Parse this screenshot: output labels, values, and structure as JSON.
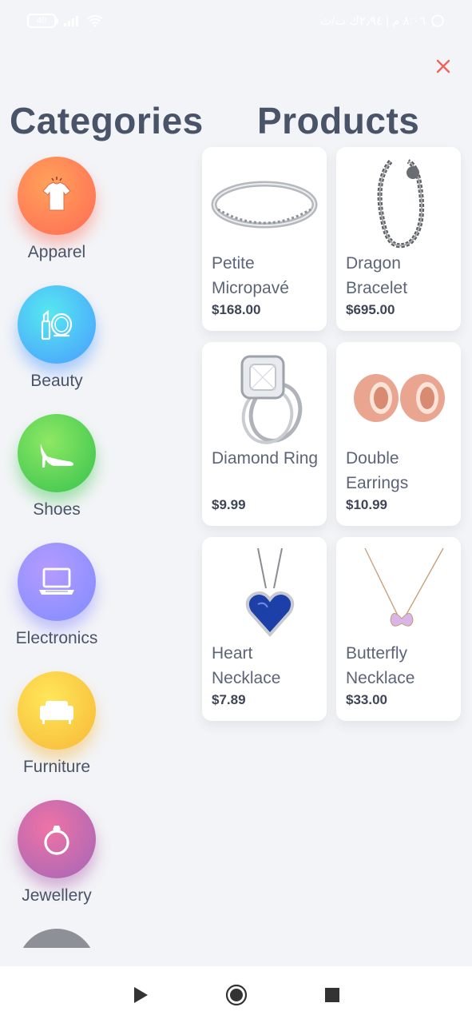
{
  "status_bar": {
    "battery": "40",
    "time": "٨:٠٦ م | ٢٫٩٤ك ب/ث"
  },
  "close_icon": "close-icon",
  "headings": {
    "categories": "Categories",
    "products": "Products"
  },
  "categories": [
    {
      "label": "Apparel",
      "icon": "shirt-icon"
    },
    {
      "label": "Beauty",
      "icon": "makeup-icon"
    },
    {
      "label": "Shoes",
      "icon": "heel-shoe-icon"
    },
    {
      "label": "Electronics",
      "icon": "laptop-icon"
    },
    {
      "label": "Furniture",
      "icon": "sofa-icon"
    },
    {
      "label": "Jewellery",
      "icon": "ring-icon"
    }
  ],
  "products": [
    {
      "name": "Petite Micropavé",
      "price": "$168.00"
    },
    {
      "name": "Dragon Bracelet",
      "price": "$695.00"
    },
    {
      "name": "Diamond Ring",
      "price": "$9.99"
    },
    {
      "name": "Double Earrings",
      "price": "$10.99"
    },
    {
      "name": "Heart Necklace",
      "price": "$7.89"
    },
    {
      "name": "Butterfly Necklace",
      "price": "$33.00"
    }
  ],
  "colors": {
    "accent_close": "#f0625a",
    "heading": "#4a5468",
    "background": "#f3f4f7"
  }
}
